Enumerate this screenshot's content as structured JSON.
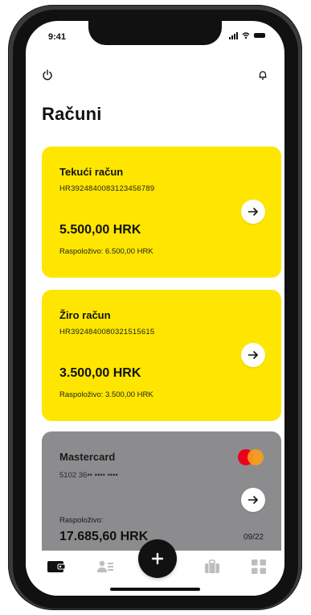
{
  "status_bar": {
    "time": "9:41"
  },
  "header": {
    "title": "Računi"
  },
  "accounts": [
    {
      "name": "Tekući račun",
      "iban": "HR3924840083123456789",
      "balance": "5.500,00 HRK",
      "available": "Raspoloživo: 6.500,00 HRK"
    },
    {
      "name": "Žiro račun",
      "iban": "HR3924840080321515615",
      "balance": "3.500,00 HRK",
      "available": "Raspoloživo: 3.500,00 HRK"
    }
  ],
  "credit_card": {
    "name": "Mastercard",
    "number": "5102 36•• •••• ••••",
    "available_label": "Raspoloživo:",
    "balance": "17.685,60 HRK",
    "expiry": "09/22"
  },
  "colors": {
    "accent_yellow": "#ffe600",
    "card_grey": "#8c8c8e",
    "ink": "#111111",
    "mastercard_red": "#eb001b",
    "mastercard_orange": "#f79e1b"
  },
  "icons": {
    "power": "power-icon",
    "bell": "bell-icon",
    "arrow": "arrow-right-icon",
    "tabs": [
      "wallet-icon",
      "users-icon",
      "plus-icon",
      "briefcase-icon",
      "grid-icon"
    ]
  }
}
